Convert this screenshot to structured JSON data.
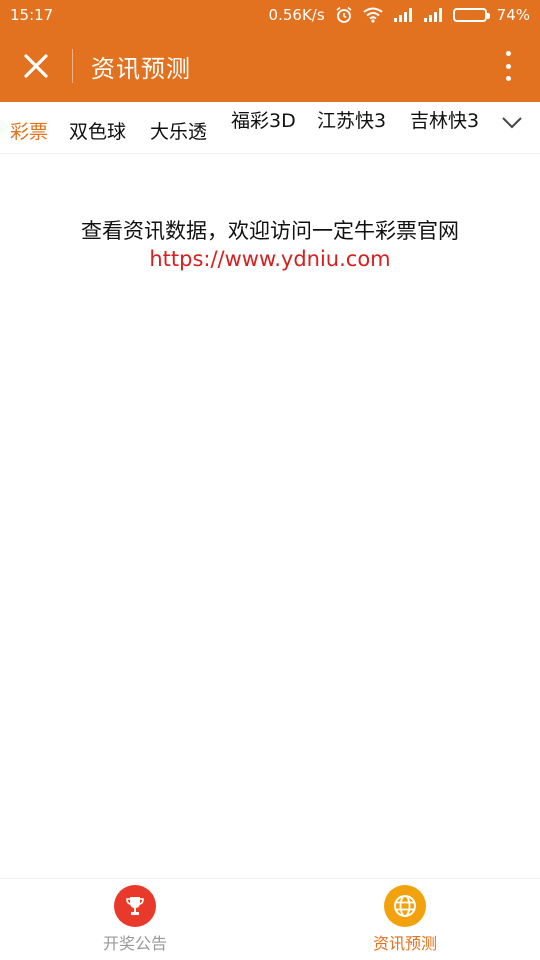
{
  "status_bar": {
    "time": "15:17",
    "network_speed": "0.56K/s",
    "battery_percent_text": "74%",
    "battery_level": 0.74,
    "icons": [
      "alarm-icon",
      "wifi-icon",
      "signal-icon",
      "signal-icon",
      "battery-icon"
    ]
  },
  "header": {
    "title": "资讯预测",
    "close_icon": "close-icon",
    "more_icon": "more-vertical-icon",
    "background": "#e2721f"
  },
  "tabs": {
    "items": [
      {
        "label": "彩票",
        "active": true
      },
      {
        "label": "双色球",
        "active": false
      },
      {
        "label": "大乐透",
        "active": false
      },
      {
        "label": "福彩3D",
        "active": false
      },
      {
        "label": "江苏快3",
        "active": false
      },
      {
        "label": "吉林快3",
        "active": false
      }
    ],
    "expand_icon": "chevron-down-icon",
    "active_color": "#e2721f"
  },
  "notice": {
    "text": "查看资讯数据，欢迎访问一定牛彩票官网",
    "link": "https://www.ydniu.com",
    "link_color": "#d81f1f"
  },
  "bottom_nav": {
    "items": [
      {
        "label": "开奖公告",
        "icon": "trophy-icon",
        "active": false,
        "color": "#e8392b"
      },
      {
        "label": "资讯预测",
        "icon": "globe-icon",
        "active": true,
        "color": "#f2a20d"
      }
    ]
  }
}
